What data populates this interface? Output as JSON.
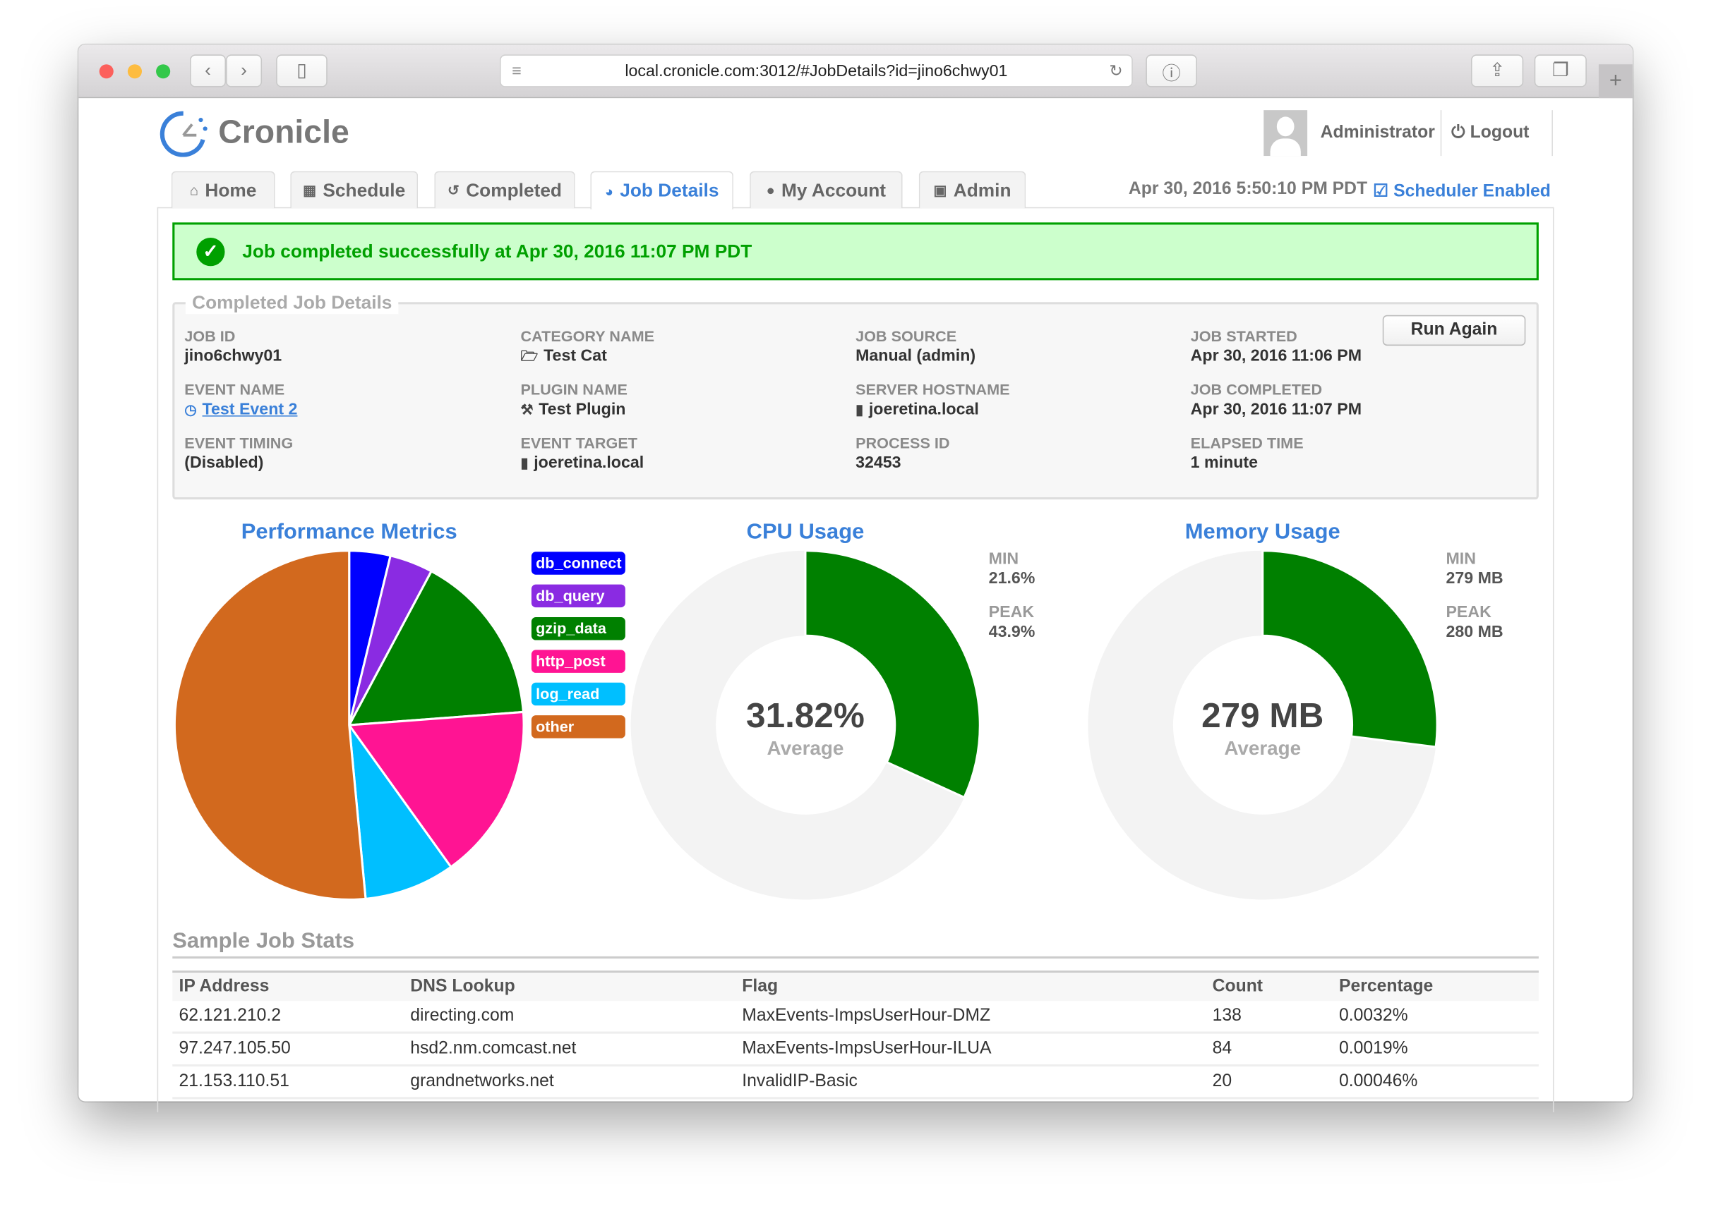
{
  "browser": {
    "url": "local.cronicle.com:3012/#JobDetails?id=jino6chwy01"
  },
  "header": {
    "logo": "Cronicle",
    "user": "Administrator",
    "logout": "Logout",
    "clock": "Apr 30, 2016 5:50:10 PM PDT",
    "scheduler": "Scheduler Enabled"
  },
  "tabs": [
    {
      "label": "Home",
      "icon": "home-icon"
    },
    {
      "label": "Schedule",
      "icon": "calendar-icon"
    },
    {
      "label": "Completed",
      "icon": "history-icon"
    },
    {
      "label": "Job Details",
      "icon": "pie-chart-icon",
      "active": true
    },
    {
      "label": "My Account",
      "icon": "user-icon"
    },
    {
      "label": "Admin",
      "icon": "lock-icon"
    }
  ],
  "banner": {
    "text": "Job completed successfully at Apr 30, 2016 11:07 PM PDT",
    "color": "#00a000"
  },
  "details": {
    "legend": "Completed Job Details",
    "run_again": "Run Again",
    "fields": [
      {
        "label": "JOB ID",
        "value": "jino6chwy01"
      },
      {
        "label": "CATEGORY NAME",
        "value": "Test Cat",
        "icon": "folder-icon"
      },
      {
        "label": "JOB SOURCE",
        "value": "Manual (admin)"
      },
      {
        "label": "JOB STARTED",
        "value": "Apr 30, 2016 11:06 PM"
      },
      {
        "label": "EVENT NAME",
        "value": "Test Event 2",
        "icon": "clock-icon",
        "link": true
      },
      {
        "label": "PLUGIN NAME",
        "value": "Test Plugin",
        "icon": "plug-icon"
      },
      {
        "label": "SERVER HOSTNAME",
        "value": "joeretina.local",
        "icon": "server-icon"
      },
      {
        "label": "JOB COMPLETED",
        "value": "Apr 30, 2016 11:07 PM"
      },
      {
        "label": "EVENT TIMING",
        "value": "(Disabled)"
      },
      {
        "label": "EVENT TARGET",
        "value": "joeretina.local",
        "icon": "server-icon"
      },
      {
        "label": "PROCESS ID",
        "value": "32453"
      },
      {
        "label": "ELAPSED TIME",
        "value": "1 minute"
      }
    ]
  },
  "chart_data": [
    {
      "type": "pie",
      "title": "Performance Metrics",
      "categories": [
        "db_connect",
        "db_query",
        "gzip_data",
        "http_post",
        "log_read",
        "other"
      ],
      "values": [
        3.8,
        4.0,
        16.0,
        16.3,
        8.4,
        51.5
      ],
      "colors": [
        "#0000ff",
        "#8a2be2",
        "#008000",
        "#ff1493",
        "#00bfff",
        "#d2691e"
      ],
      "legend": "right"
    },
    {
      "type": "donut",
      "title": "CPU Usage",
      "value": 31.82,
      "fill_fraction": 0.318,
      "center_label": "31.82%",
      "center_sub": "Average",
      "min_label": "MIN",
      "min": "21.6%",
      "peak_label": "PEAK",
      "peak": "43.9%",
      "color": "#008000"
    },
    {
      "type": "donut",
      "title": "Memory Usage",
      "value": 279,
      "fill_fraction": 0.27,
      "center_label": "279 MB",
      "center_sub": "Average",
      "min_label": "MIN",
      "min": "279 MB",
      "peak_label": "PEAK",
      "peak": "280 MB",
      "color": "#008000"
    }
  ],
  "stats": {
    "title": "Sample Job Stats",
    "columns": [
      "IP Address",
      "DNS Lookup",
      "Flag",
      "Count",
      "Percentage"
    ],
    "rows": [
      [
        "62.121.210.2",
        "directing.com",
        "MaxEvents-ImpsUserHour-DMZ",
        "138",
        "0.0032%"
      ],
      [
        "97.247.105.50",
        "hsd2.nm.comcast.net",
        "MaxEvents-ImpsUserHour-ILUA",
        "84",
        "0.0019%"
      ],
      [
        "21.153.110.51",
        "grandnetworks.net",
        "InvalidIP-Basic",
        "20",
        "0.00046%"
      ]
    ]
  }
}
